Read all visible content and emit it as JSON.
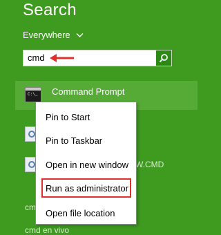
{
  "header": {
    "title": "Search",
    "scope_label": "Everywhere"
  },
  "search": {
    "query": "cmd",
    "search_icon": "magnifier-icon"
  },
  "results": {
    "selected": {
      "label": "Command Prompt",
      "icon": "command-prompt-icon"
    },
    "background": {
      "partial_cmd_text": "W.CMD",
      "item4_text": "cmd",
      "item5_text": "cmd en vivo"
    }
  },
  "context_menu": {
    "items": [
      "Pin to Start",
      "Pin to Taskbar",
      "Open in new window",
      "Run as administrator",
      "Open file location"
    ],
    "highlighted_item": "Run as administrator"
  },
  "annotation": {
    "highlight_color": "#e0302a",
    "arrow_color": "#e0302a"
  },
  "colors": {
    "background": "#3f9b20",
    "selected_result": "#56ab36",
    "search_button": "#2a8a14"
  }
}
